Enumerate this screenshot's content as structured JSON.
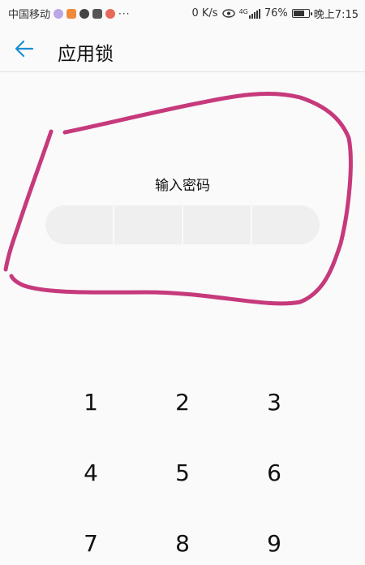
{
  "status_bar": {
    "carrier": "中国移动",
    "more": "···",
    "net_speed": "0 K/s",
    "network_type": "4G",
    "battery": "76%",
    "battery_level": 0.76,
    "time": "晚上7:15",
    "app_icons": [
      {
        "name": "notification-app-icon-1",
        "color": "#b9a7e6"
      },
      {
        "name": "notification-app-icon-2",
        "color": "#f08a3c"
      },
      {
        "name": "notification-app-icon-3",
        "color": "#444444"
      },
      {
        "name": "notification-app-icon-4",
        "color": "#555555"
      },
      {
        "name": "notification-app-icon-5",
        "color": "#e66a5a"
      }
    ],
    "icons": [
      "eye-icon",
      "signal-icon",
      "battery-icon"
    ]
  },
  "header": {
    "title": "应用锁",
    "back_icon": "arrow-left-icon",
    "accent_color": "#1a8fd6"
  },
  "pin": {
    "prompt": "输入密码",
    "digits": 4
  },
  "annotation": {
    "color": "#c63a7c"
  },
  "keypad": {
    "keys": [
      "1",
      "2",
      "3",
      "4",
      "5",
      "6",
      "7",
      "8",
      "9"
    ]
  }
}
